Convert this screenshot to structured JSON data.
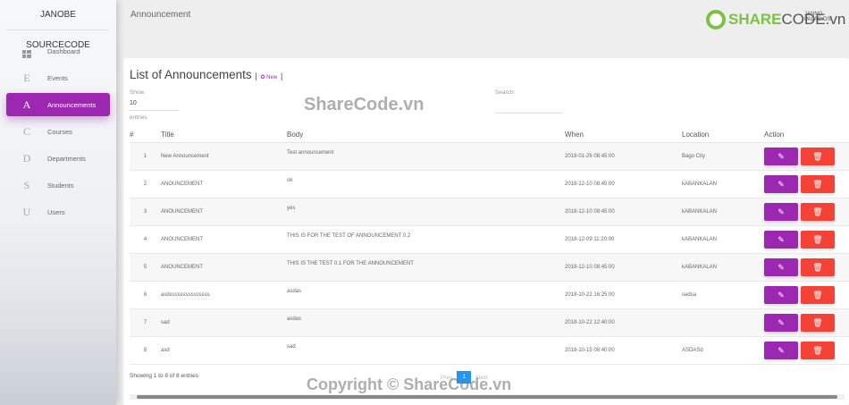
{
  "sidebar": {
    "brand": "JANOBE SOURCECODE",
    "items": [
      {
        "icon": "dashboard-icon",
        "glyph": "",
        "label": "Dashboard"
      },
      {
        "icon": "letter-e-icon",
        "glyph": "E",
        "label": "Events"
      },
      {
        "icon": "letter-a-icon",
        "glyph": "A",
        "label": "Announcements",
        "active": true
      },
      {
        "icon": "letter-c-icon",
        "glyph": "C",
        "label": "Courses"
      },
      {
        "icon": "letter-d-icon",
        "glyph": "D",
        "label": "Departments"
      },
      {
        "icon": "letter-s-icon",
        "glyph": "S",
        "label": "Students"
      },
      {
        "icon": "letter-u-icon",
        "glyph": "U",
        "label": "Users"
      }
    ]
  },
  "header": {
    "title": "Announcement",
    "user": "JANNO PALACIOS",
    "logo": "SHARECODE.vn"
  },
  "card": {
    "title": "List of Announcements",
    "new_label": "New",
    "show_label": "Show",
    "length": "10",
    "entries_label": "entries",
    "search_label": "Search:",
    "search_value": ""
  },
  "table": {
    "columns": [
      "#",
      "Title",
      "Body",
      "When",
      "Location",
      "Action"
    ],
    "rows": [
      [
        "1",
        "New Announcement",
        "Test announcement",
        "2019-01-26 08:45:00",
        "Bago City"
      ],
      [
        "2",
        "ANOUNCEMENT",
        "ok",
        "2018-12-10 08:45:00",
        "kABANKALAN"
      ],
      [
        "3",
        "ANOUNCEMENT",
        "yes",
        "2018-12-10 08:45:00",
        "kABANKALAN"
      ],
      [
        "4",
        "ANOUNCEMENT",
        "THIS IS FOR THE TEST OF ANNOUNCEMENT 0.2",
        "2018-12-09 11:20:00",
        "kABANKALAN"
      ],
      [
        "5",
        "ANOUNCEMENT",
        "THIS IS THE TEST 0.1 FOR THE ANNOUNCEMENT",
        "2018-12-10 08:45:00",
        "kABANKALAN"
      ],
      [
        "6",
        "asdsssssssssssssss",
        "asdas",
        "2018-10-22 16:25:00",
        "sadsa"
      ],
      [
        "7",
        "sad",
        "asdas",
        "2018-10-22 12:40:00",
        ""
      ],
      [
        "8",
        "asd",
        "sad",
        "2018-10-15 08:40:00",
        "ASDASd"
      ]
    ]
  },
  "footer": {
    "info": "Showing 1 to 8 of 8 entries",
    "prev": "Prev",
    "page": "1",
    "next": "Next"
  },
  "watermarks": {
    "center": "ShareCode.vn",
    "bottom": "Copyright © ShareCode.vn"
  },
  "colors": {
    "primary": "#9c27b0",
    "danger": "#f44336",
    "page_active": "#2196f3"
  }
}
